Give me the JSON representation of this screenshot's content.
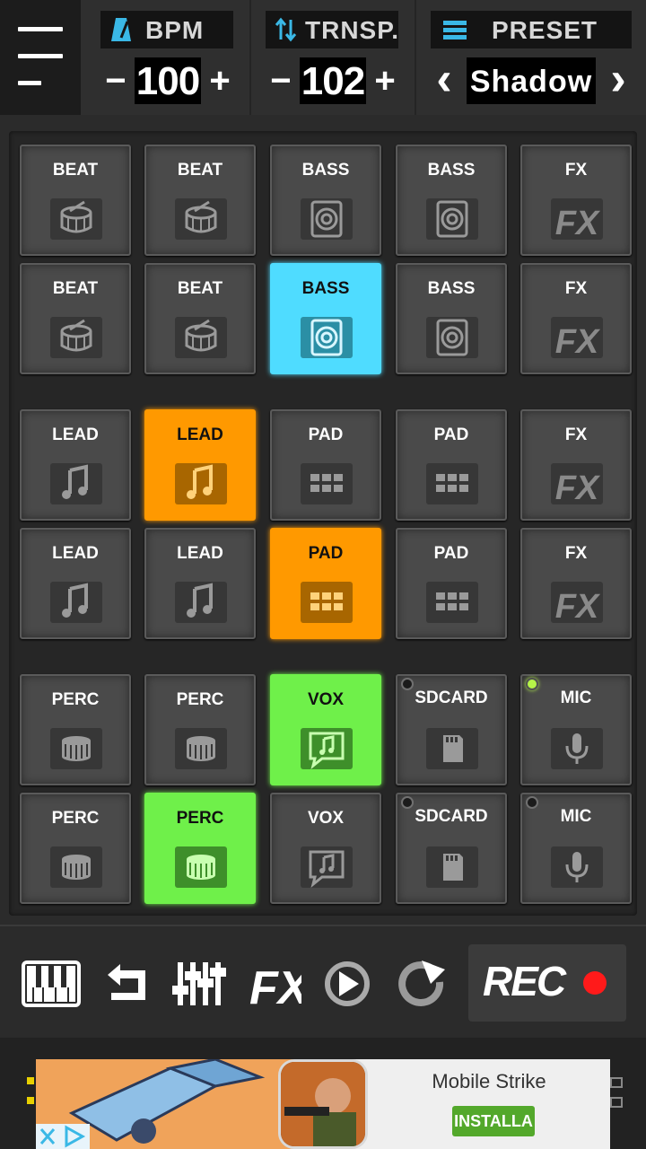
{
  "topbar": {
    "bpm": {
      "label": "BPM",
      "value": "100",
      "minus": "−",
      "plus": "+"
    },
    "transpose": {
      "label": "TRNSP.",
      "value": "102",
      "minus": "−",
      "plus": "+"
    },
    "preset": {
      "label": "PRESET",
      "value": "Shadow",
      "prev": "‹",
      "next": "›"
    }
  },
  "pads": [
    {
      "label": "BEAT",
      "icon": "drum-icon",
      "state": "off"
    },
    {
      "label": "BEAT",
      "icon": "drum-icon",
      "state": "off"
    },
    {
      "label": "BASS",
      "icon": "speaker-icon",
      "state": "off"
    },
    {
      "label": "BASS",
      "icon": "speaker-icon",
      "state": "off"
    },
    {
      "label": "FX",
      "icon": "fx-icon",
      "state": "off"
    },
    {
      "label": "BEAT",
      "icon": "drum-icon",
      "state": "off"
    },
    {
      "label": "BEAT",
      "icon": "drum-icon",
      "state": "off"
    },
    {
      "label": "BASS",
      "icon": "speaker-icon",
      "state": "cyan"
    },
    {
      "label": "BASS",
      "icon": "speaker-icon",
      "state": "off"
    },
    {
      "label": "FX",
      "icon": "fx-icon",
      "state": "off"
    },
    {
      "label": "LEAD",
      "icon": "note-icon",
      "state": "off"
    },
    {
      "label": "LEAD",
      "icon": "note-icon",
      "state": "orange"
    },
    {
      "label": "PAD",
      "icon": "grid-icon",
      "state": "off"
    },
    {
      "label": "PAD",
      "icon": "grid-icon",
      "state": "off"
    },
    {
      "label": "FX",
      "icon": "fx-icon",
      "state": "off"
    },
    {
      "label": "LEAD",
      "icon": "note-icon",
      "state": "off"
    },
    {
      "label": "LEAD",
      "icon": "note-icon",
      "state": "off"
    },
    {
      "label": "PAD",
      "icon": "grid-icon",
      "state": "orange"
    },
    {
      "label": "PAD",
      "icon": "grid-icon",
      "state": "off"
    },
    {
      "label": "FX",
      "icon": "fx-icon",
      "state": "off"
    },
    {
      "label": "PERC",
      "icon": "snare-icon",
      "state": "off"
    },
    {
      "label": "PERC",
      "icon": "snare-icon",
      "state": "off"
    },
    {
      "label": "VOX",
      "icon": "vox-icon",
      "state": "green"
    },
    {
      "label": "SDCARD",
      "icon": "sdcard-icon",
      "state": "off",
      "led": "off"
    },
    {
      "label": "MIC",
      "icon": "mic-icon",
      "state": "off",
      "led": "on"
    },
    {
      "label": "PERC",
      "icon": "snare-icon",
      "state": "off"
    },
    {
      "label": "PERC",
      "icon": "snare-icon",
      "state": "green"
    },
    {
      "label": "VOX",
      "icon": "vox-icon",
      "state": "off"
    },
    {
      "label": "SDCARD",
      "icon": "sdcard-icon",
      "state": "off",
      "led": "off"
    },
    {
      "label": "MIC",
      "icon": "mic-icon",
      "state": "off",
      "led": "off"
    }
  ],
  "toolbar": {
    "items": [
      "piano-keys-icon",
      "undo-icon",
      "mixer-icon",
      "fx-icon",
      "play-icon",
      "redo-icon"
    ],
    "rec_label": "REC"
  },
  "ad": {
    "title": "Mobile Strike",
    "cta": "INSTALLA"
  },
  "colors": {
    "accent_cyan": "#4fdcff",
    "accent_orange": "#ff9900",
    "accent_green": "#6ff04a",
    "rec_red": "#ff1a1a",
    "header_icon_blue": "#3ab8e6"
  }
}
